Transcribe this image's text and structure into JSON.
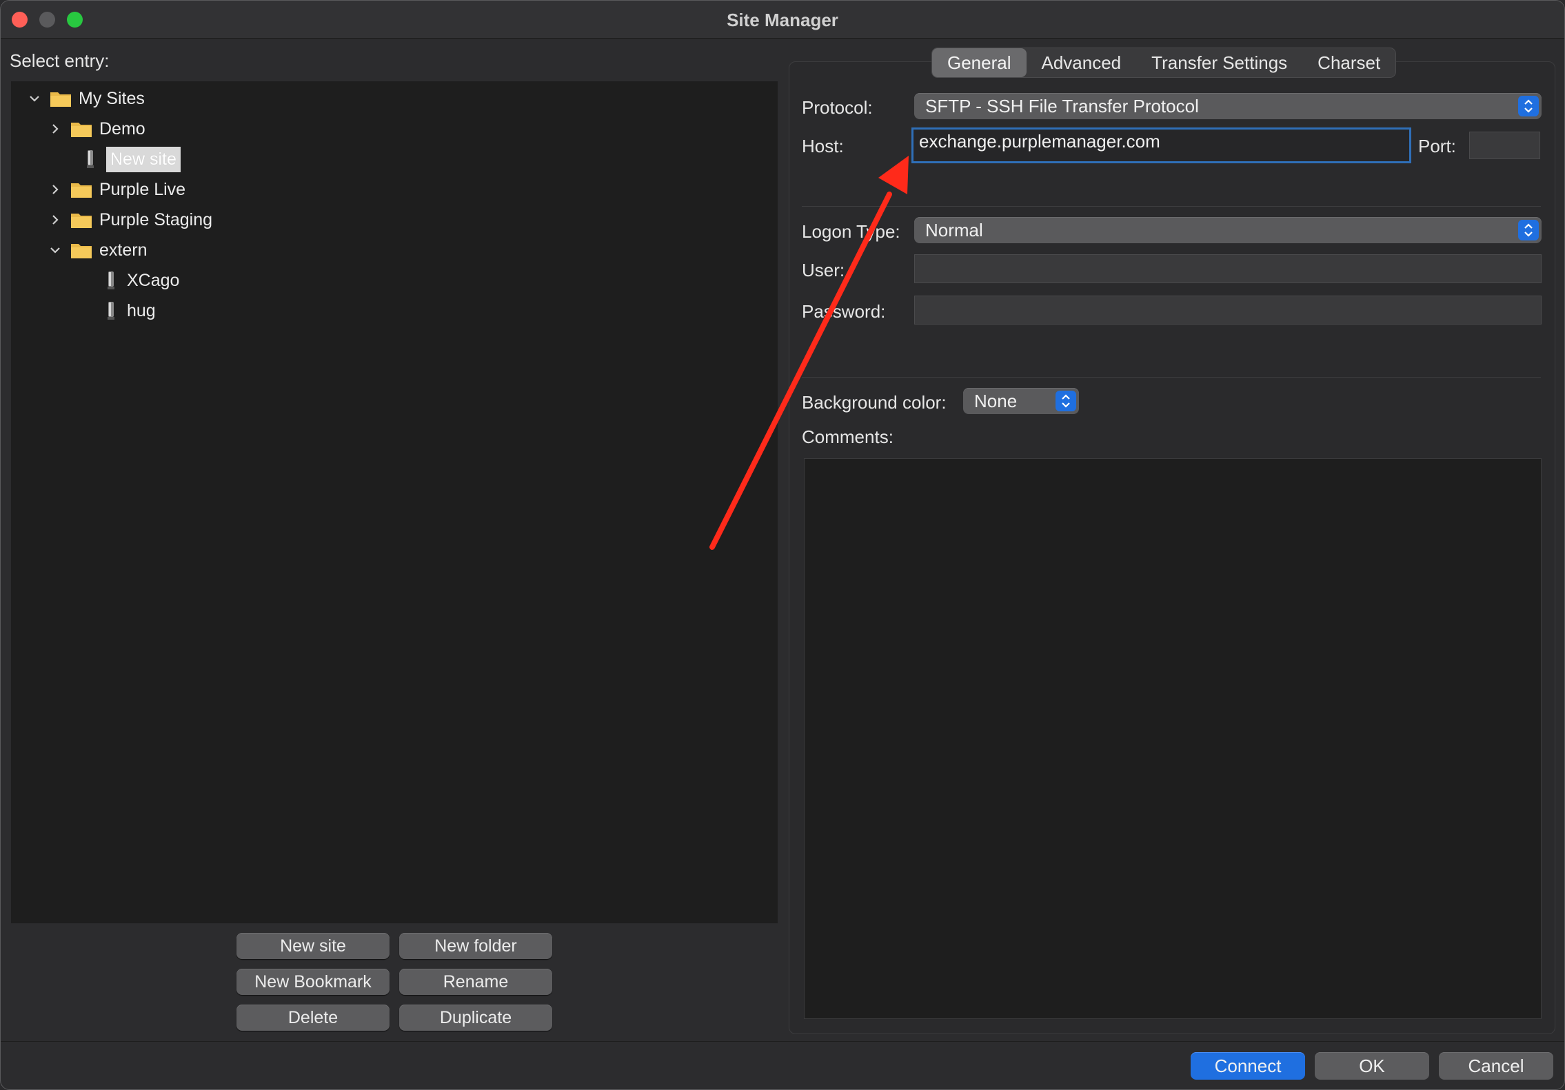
{
  "window": {
    "title": "Site Manager"
  },
  "tree": {
    "heading": "Select entry:",
    "items": [
      {
        "label": "My Sites"
      },
      {
        "label": "Demo"
      },
      {
        "label": "New site"
      },
      {
        "label": "Purple Live"
      },
      {
        "label": "Purple Staging"
      },
      {
        "label": "extern"
      },
      {
        "label": "XCago"
      },
      {
        "label": "hug"
      }
    ]
  },
  "tree_buttons": {
    "new_site": "New site",
    "new_folder": "New folder",
    "new_bookmark": "New Bookmark",
    "rename": "Rename",
    "delete": "Delete",
    "duplicate": "Duplicate"
  },
  "tabs": [
    {
      "label": "General"
    },
    {
      "label": "Advanced"
    },
    {
      "label": "Transfer Settings"
    },
    {
      "label": "Charset"
    }
  ],
  "general": {
    "protocol_label": "Protocol:",
    "protocol_value": "SFTP - SSH File Transfer Protocol",
    "host_label": "Host:",
    "host_value": "exchange.purplemanager.com",
    "port_label": "Port:",
    "port_value": "",
    "logon_type_label": "Logon Type:",
    "logon_type_value": "Normal",
    "user_label": "User:",
    "user_value": "",
    "password_label": "Password:",
    "password_value": "",
    "bg_color_label": "Background color:",
    "bg_color_value": "None",
    "comments_label": "Comments:"
  },
  "footer": {
    "connect": "Connect",
    "ok": "OK",
    "cancel": "Cancel"
  },
  "colors": {
    "accent": "#1f6fe0",
    "annotation_arrow": "#ff2a1a"
  }
}
